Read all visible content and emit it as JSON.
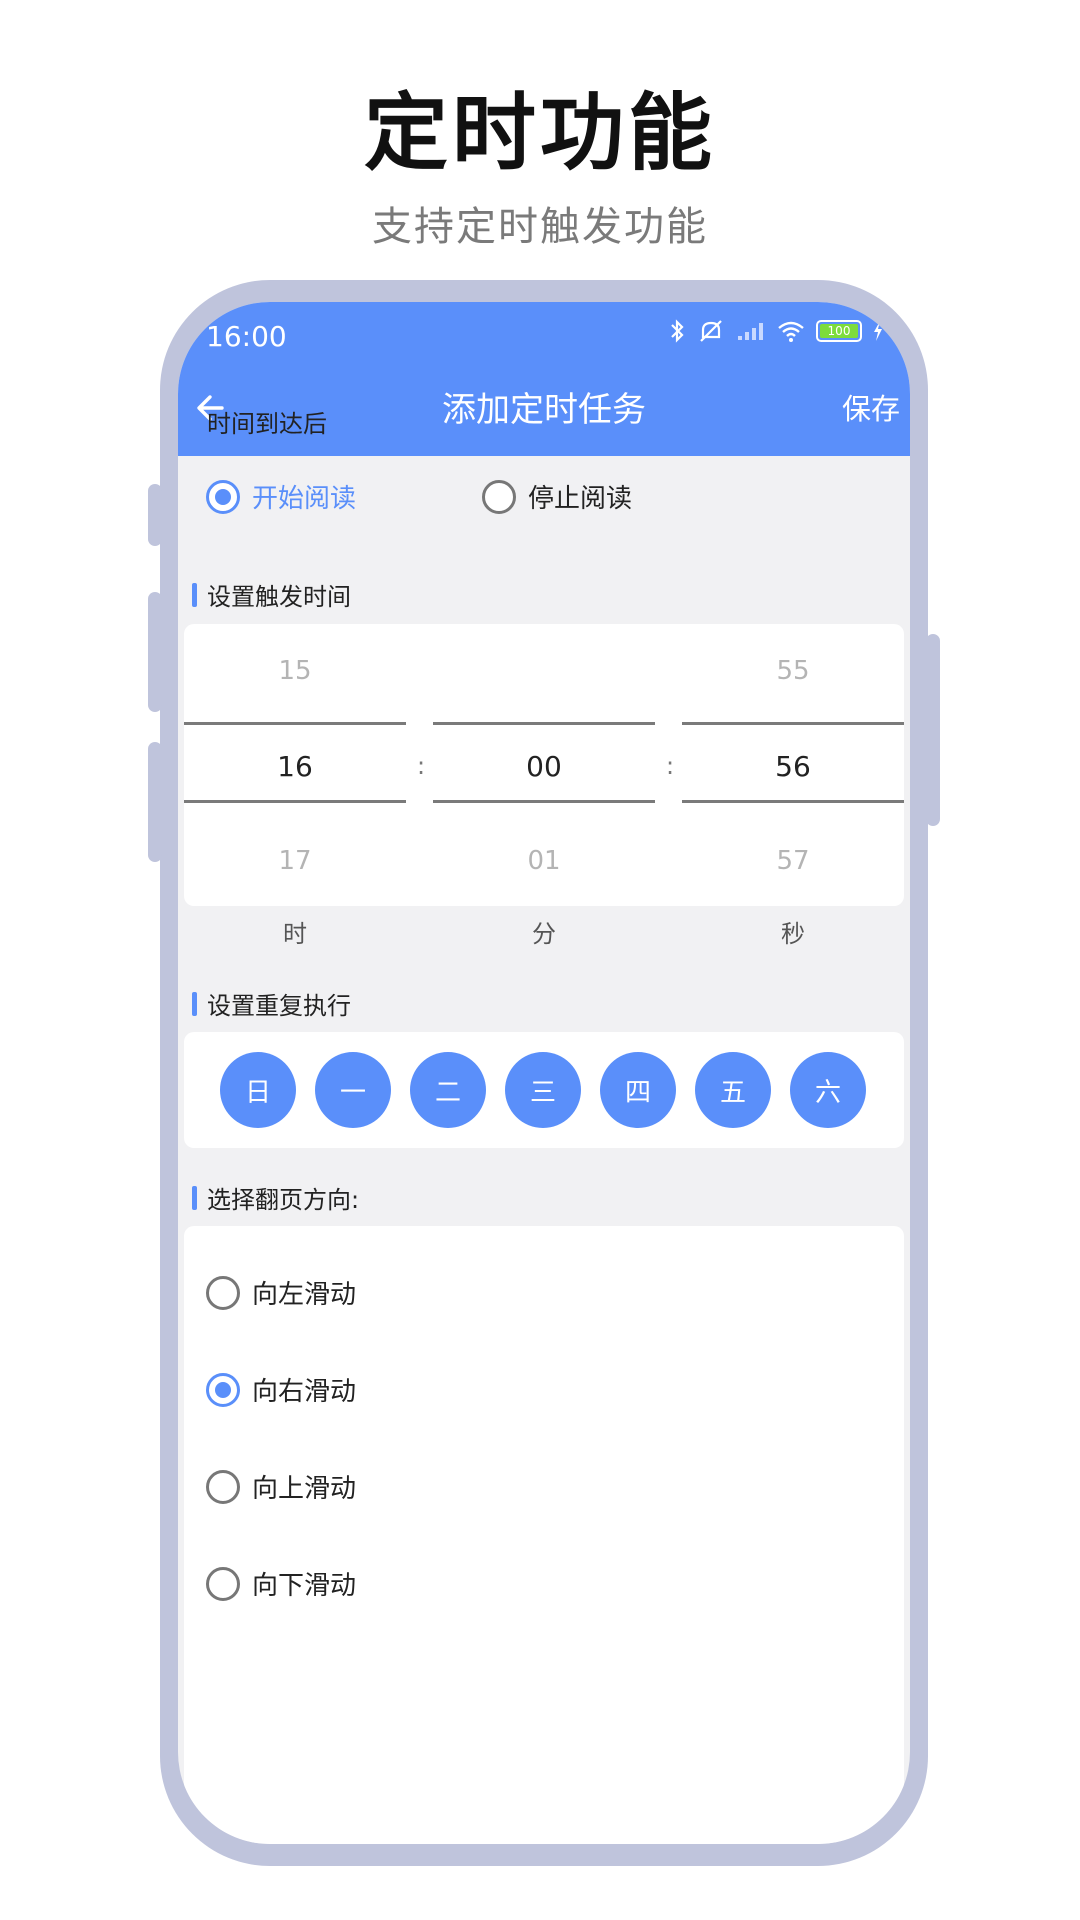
{
  "promo": {
    "title": "定时功能",
    "subtitle": "支持定时触发功能"
  },
  "status_bar": {
    "time": "16:00",
    "battery": "100",
    "icons": [
      "bluetooth-icon",
      "mute-icon",
      "signal-icon",
      "wifi-icon",
      "battery-icon",
      "charging-icon"
    ]
  },
  "app_bar": {
    "title": "添加定时任务",
    "save": "保存",
    "back_icon": "back-arrow-icon"
  },
  "section_after": {
    "title": "时间到达后",
    "options": [
      "开始阅读",
      "停止阅读"
    ],
    "selected": "开始阅读"
  },
  "section_time": {
    "title": "设置触发时间",
    "hours": [
      "15",
      "16",
      "17"
    ],
    "minutes": [
      "",
      "00",
      "01"
    ],
    "seconds": [
      "55",
      "56",
      "57"
    ],
    "separator": ":",
    "units": [
      "时",
      "分",
      "秒"
    ]
  },
  "section_repeat": {
    "title": "设置重复执行",
    "days": [
      "日",
      "一",
      "二",
      "三",
      "四",
      "五",
      "六"
    ]
  },
  "section_direction": {
    "title": "选择翻页方向:",
    "options": [
      "向左滑动",
      "向右滑动",
      "向上滑动",
      "向下滑动"
    ],
    "selected": "向右滑动"
  },
  "colors": {
    "accent": "#5a8ffa",
    "frame": "#bfc4dc",
    "background": "#f1f1f3"
  }
}
